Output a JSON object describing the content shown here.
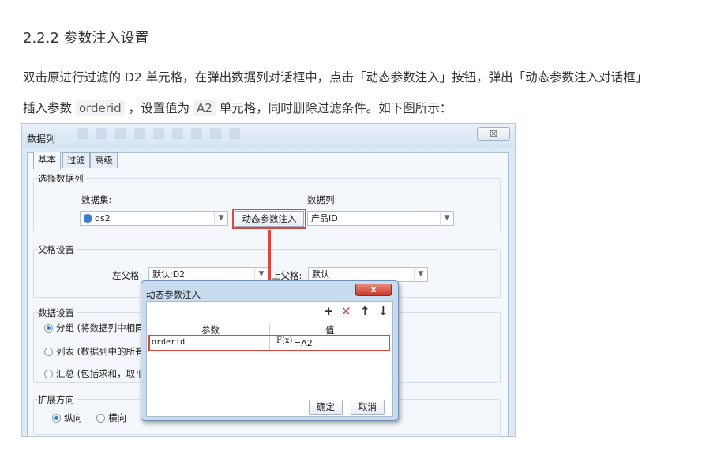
{
  "doc": {
    "heading": "2.2.2 参数注入设置",
    "p1": "双击原进行过滤的 D2 单元格，在弹出数据列对话框中，点击「动态参数注入」按钮，弹出「动态参数注入对话框」",
    "p2_pre": "插入参数",
    "p2_code1": "orderid",
    "p2_mid": "，设置值为",
    "p2_code2": "A2",
    "p2_post": "单元格，同时删除过滤条件。如下图所示："
  },
  "dialog": {
    "title": "数据列",
    "close": "☒",
    "tabs": [
      "基本",
      "过滤",
      "高级"
    ],
    "select_group": {
      "label": "选择数据列",
      "dataset_label": "数据集:",
      "dataset_value": "ds2",
      "datacol_label": "数据列:",
      "datacol_value": "产品ID",
      "inject_button": "动态参数注入"
    },
    "parent_group": {
      "label": "父格设置",
      "left_label": "左父格:",
      "left_value": "默认:D2",
      "top_label": "上父格:",
      "top_value": "默认"
    },
    "data_group": {
      "label": "数据设置",
      "options": [
        "分组 (将数据列中相同",
        "列表 (数据列中的所有",
        "汇总 (包括求和，取平"
      ]
    },
    "expand_group": {
      "label": "扩展方向",
      "options": [
        "纵向",
        "横向"
      ]
    }
  },
  "inject_dialog": {
    "title": "动态参数注入",
    "close": "x",
    "toolbar": [
      "+",
      "✕",
      "↑",
      "↓"
    ],
    "columns": [
      "参数",
      "值"
    ],
    "rows": [
      {
        "param": "orderid",
        "fx": "F(x)",
        "value": "=A2"
      }
    ],
    "ok": "确定",
    "cancel": "取消"
  },
  "colors": {
    "highlight": "#e0443a",
    "toolbar_delete": "#e0443a"
  }
}
